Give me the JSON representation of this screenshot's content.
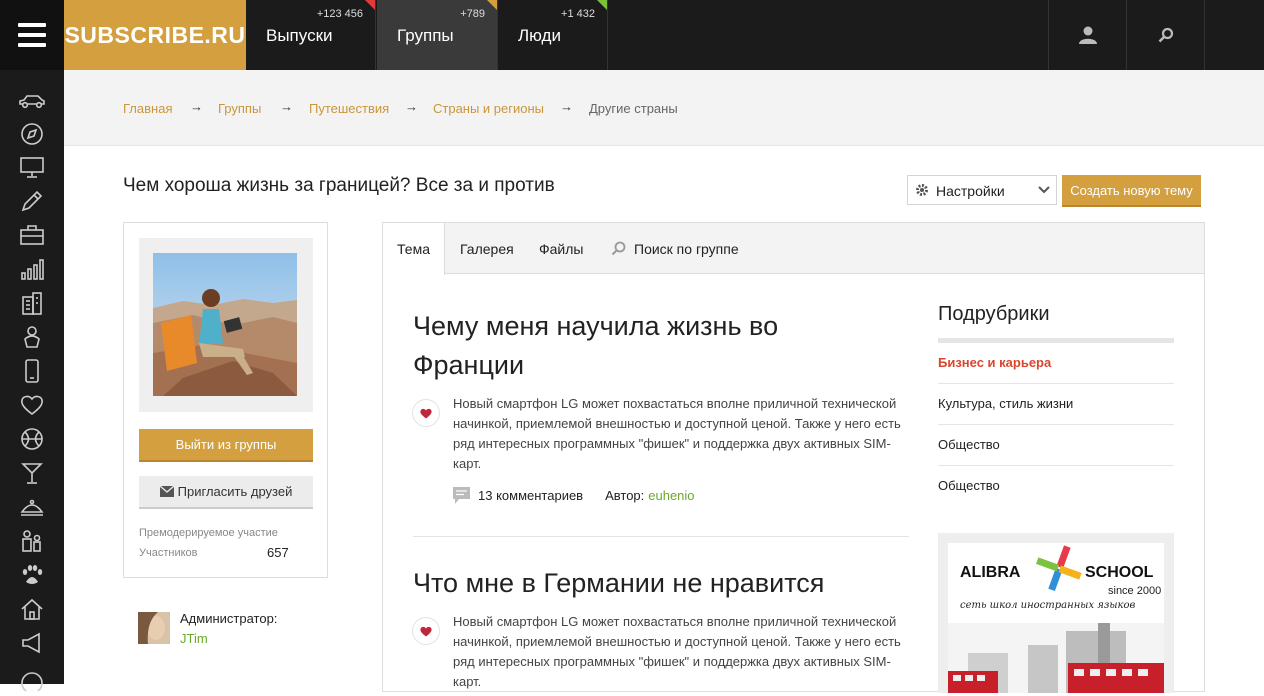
{
  "header": {
    "logo": "SUBSCRIBE.RU",
    "tabs": [
      {
        "label": "Выпуски",
        "count": "+123 456"
      },
      {
        "label": "Группы",
        "count": "+789"
      },
      {
        "label": "Люди",
        "count": "+1 432"
      }
    ],
    "colors": {
      "accent": "#d39f3f",
      "dark": "#1b1b1b",
      "red": "#e03a3a",
      "green": "#7cbf3a"
    }
  },
  "sidebar": {
    "icons": [
      "car-icon",
      "compass-icon",
      "monitor-icon",
      "pen-icon",
      "briefcase-icon",
      "bar-chart-icon",
      "building-icon",
      "baby-icon",
      "phone-icon",
      "heart-icon",
      "basketball-icon",
      "cocktail-icon",
      "dish-icon",
      "family-icon",
      "paw-icon",
      "house-icon",
      "megaphone-icon"
    ]
  },
  "breadcrumb": [
    "Главная",
    "Группы",
    "Путешествия",
    "Страны и регионы",
    "Другие страны"
  ],
  "page": {
    "title": "Чем хороша жизнь за границей? Все за и против",
    "settings_label": "Настройки",
    "create_label": "Создать новую тему"
  },
  "group": {
    "leave_label": "Выйти из группы",
    "invite_label": "Пригласить друзей",
    "moderation": "Премодерируемое участие",
    "members_label": "Участников",
    "members_count": "657",
    "admin_label": "Администратор:",
    "admin_name": "JTim"
  },
  "tabs": {
    "topic": "Тема",
    "gallery": "Галерея",
    "files": "Файлы",
    "search": "Поиск по группе"
  },
  "articles": [
    {
      "title": "Чему меня научила жизнь во Франции",
      "text": "Новый смартфон LG может похвастаться вполне приличной технической начинкой, приемлемой внешностью и доступной ценой. Также у него есть ряд интересных программных \"фишек\" и поддержка двух активных SIM-карт.",
      "comments": "13 комментариев",
      "author_label": "Автор:",
      "author": "euhenio"
    },
    {
      "title": "Что мне в Германии не нравится",
      "text": "Новый смартфон LG может похвастаться вполне приличной технической начинкой, приемлемой внешностью и доступной ценой. Также у него есть ряд интересных программных \"фишек\" и поддержка двух активных SIM-карт."
    }
  ],
  "subrubrics": {
    "title": "Подрубрики",
    "items": [
      "Бизнес и карьера",
      "Культура, стиль жизни",
      "Общество",
      "Общество"
    ]
  },
  "ad": {
    "brand_left": "ALIBRA",
    "brand_right": "SCHOOL",
    "since": "since 2000",
    "tagline": "сеть школ иностранных языков"
  }
}
